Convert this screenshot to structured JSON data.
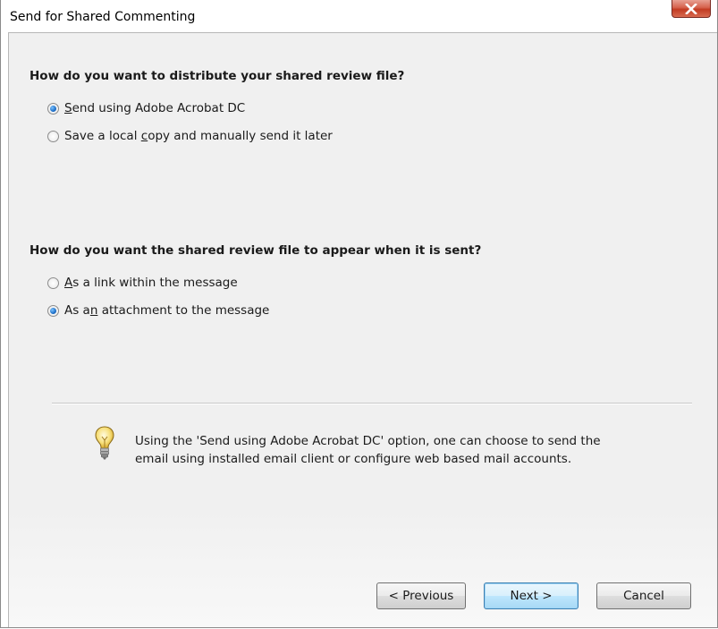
{
  "window": {
    "title": "Send for Shared Commenting"
  },
  "distribution": {
    "question": "How do you want to distribute your shared review file?",
    "options": [
      {
        "pre": "",
        "accel": "S",
        "post": "end using Adobe Acrobat DC",
        "checked": true
      },
      {
        "pre": "Save a local ",
        "accel": "c",
        "post": "opy and manually send it later",
        "checked": false
      }
    ]
  },
  "appearance": {
    "question": "How do you want the shared review file to appear when it is sent?",
    "options": [
      {
        "pre": "",
        "accel": "A",
        "post": "s a link within the message",
        "checked": false
      },
      {
        "pre": "As a",
        "accel": "n",
        "post": " attachment to the message",
        "checked": true
      }
    ]
  },
  "info": {
    "icon": "lightbulb-icon",
    "line1": "Using the 'Send using Adobe Acrobat DC' option, one can choose to send the",
    "line2": "email using installed email client or configure web based mail accounts."
  },
  "buttons": {
    "previous": "< Previous",
    "next": "Next >",
    "cancel": "Cancel"
  },
  "colors": {
    "close_button": "#c23b22",
    "radio_selected": "#1e6fc7",
    "default_button_border": "#3c7fb1"
  }
}
